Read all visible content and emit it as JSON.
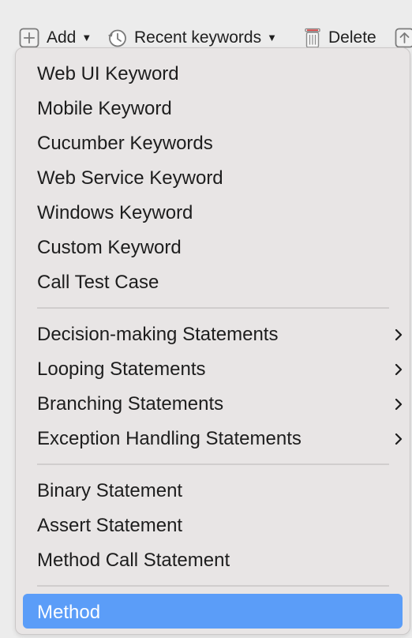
{
  "toolbar": {
    "add_label": "Add",
    "recent_keywords_label": "Recent keywords",
    "delete_label": "Delete"
  },
  "menu": {
    "group1": [
      "Web UI Keyword",
      "Mobile Keyword",
      "Cucumber Keywords",
      "Web Service Keyword",
      "Windows Keyword",
      "Custom Keyword",
      "Call Test Case"
    ],
    "group2": [
      "Decision-making Statements",
      "Looping Statements",
      "Branching Statements",
      "Exception Handling Statements"
    ],
    "group3": [
      "Binary Statement",
      "Assert Statement",
      "Method Call Statement"
    ],
    "group4": [
      "Method"
    ],
    "selected_item": "Method"
  },
  "colors": {
    "menu_background": "#e8e5e5",
    "selection": "#5b9df8",
    "separator": "#d0cdcd"
  },
  "icons": {
    "add": "plus-box-icon",
    "recent": "clock-history-icon",
    "delete": "trash-icon",
    "submenu": "chevron-right-icon",
    "partial": "arrow-up-box-icon"
  }
}
